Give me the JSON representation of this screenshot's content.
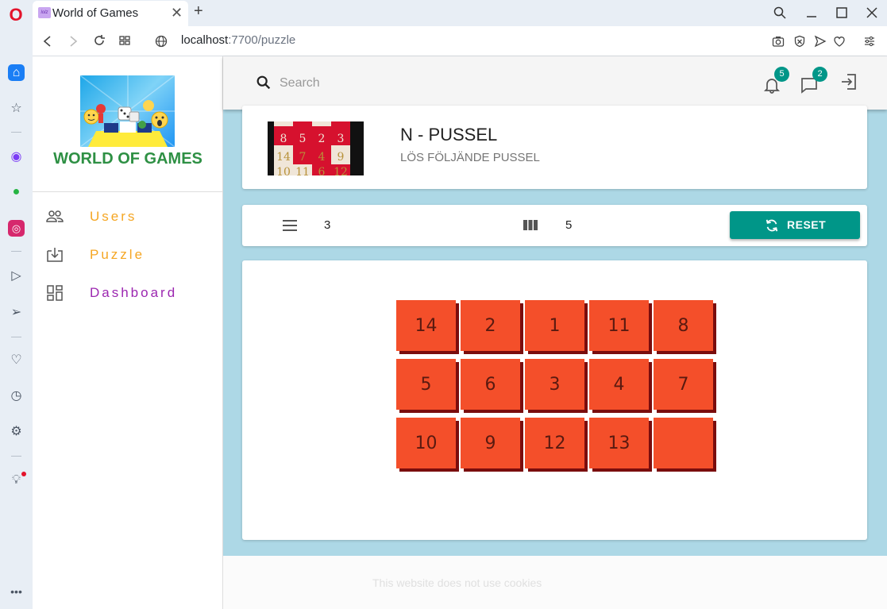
{
  "browser": {
    "tab_title": "World of Games",
    "url_host": "localhost",
    "url_rest": ":7700/puzzle"
  },
  "nav": {
    "brand": "WORLD OF GAMES",
    "items": [
      {
        "label": "Users",
        "icon": "people-icon",
        "color": "#f5a623"
      },
      {
        "label": "Puzzle",
        "icon": "download-box-icon",
        "color": "#f5a623"
      },
      {
        "label": "Dashboard",
        "icon": "dashboard-icon",
        "color": "#9c27b0"
      }
    ]
  },
  "topbar": {
    "search_placeholder": "Search",
    "notifications_count": "5",
    "messages_count": "2"
  },
  "header": {
    "title": "N - PUSSEL",
    "subtitle": "LÖS FÖLJÄNDE PUSSEL"
  },
  "controls": {
    "rows": "3",
    "cols": "5",
    "reset_label": "RESET"
  },
  "board": {
    "tiles": [
      [
        "14",
        "2",
        "1",
        "11",
        "8"
      ],
      [
        "5",
        "6",
        "3",
        "4",
        "7"
      ],
      [
        "10",
        "9",
        "12",
        "13",
        ""
      ]
    ],
    "tile_color": "#f44f2a"
  },
  "footer": {
    "cookie_text": "This website does not use cookies"
  },
  "colors": {
    "accent": "#009688",
    "background": "#add8e6"
  }
}
